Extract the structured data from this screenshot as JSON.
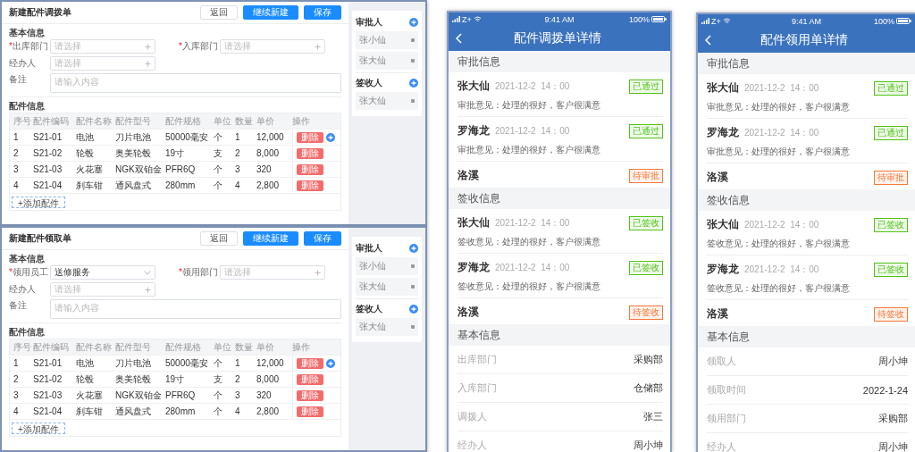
{
  "forms": [
    {
      "title": "新建配件调拨单",
      "buttons": [
        {
          "label": "返回",
          "kind": "default"
        },
        {
          "label": "继续新建",
          "kind": "primary"
        },
        {
          "label": "保存",
          "kind": "primary"
        }
      ],
      "basic_title": "基本信息",
      "fields": [
        {
          "mark": "*",
          "label": "出库部门",
          "kind": "picker",
          "placeholder": "请选择"
        },
        {
          "mark": "*",
          "label": "入库部门",
          "kind": "picker",
          "placeholder": "请选择"
        },
        {
          "label": "经办人",
          "kind": "picker",
          "placeholder": "请选择"
        },
        {
          "label": "备注",
          "kind": "textarea",
          "placeholder": "请输入内容"
        }
      ],
      "parts_title": "配件信息",
      "table": {
        "columns": [
          "序号",
          "配件编码",
          "配件名称",
          "配件型号",
          "配件规格",
          "单位",
          "数量",
          "单价",
          "操作"
        ],
        "rows": [
          {
            "cells": [
              "1",
              "S21-01",
              "电池",
              "刀片电池",
              "50000毫安",
              "个",
              "1",
              "12,000"
            ],
            "action": "删除",
            "add_icon": true
          },
          {
            "cells": [
              "2",
              "S21-02",
              "轮毂",
              "奥美轮毂",
              "19寸",
              "支",
              "2",
              "8,000"
            ],
            "action": "删除",
            "add_icon": false
          },
          {
            "cells": [
              "3",
              "S21-03",
              "火花塞",
              "NGK双铂金",
              "PFR6Q",
              "个",
              "3",
              "320"
            ],
            "action": "删除",
            "add_icon": false
          },
          {
            "cells": [
              "4",
              "S21-04",
              "刹车钳",
              "通风盘式",
              "280mm",
              "个",
              "4",
              "2,800"
            ],
            "action": "删除",
            "add_icon": false
          }
        ]
      },
      "add_button": "+添加配件",
      "panels": [
        {
          "title": "审批人",
          "people": [
            "张小仙",
            "张大仙"
          ]
        },
        {
          "title": "签收人",
          "people": [
            "张大仙"
          ]
        }
      ]
    },
    {
      "title": "新建配件领取单",
      "buttons": [
        {
          "label": "返回",
          "kind": "default"
        },
        {
          "label": "继续新建",
          "kind": "primary"
        },
        {
          "label": "保存",
          "kind": "primary"
        }
      ],
      "basic_title": "基本信息",
      "fields": [
        {
          "mark": "*",
          "label": "领用员工",
          "kind": "select",
          "value": "送修服务"
        },
        {
          "mark": "*",
          "label": "领用部门",
          "kind": "picker",
          "placeholder": "请选择"
        },
        {
          "label": "经办人",
          "kind": "picker",
          "placeholder": "请选择"
        },
        {
          "label": "备注",
          "kind": "textarea",
          "placeholder": "请输入内容"
        }
      ],
      "parts_title": "配件信息",
      "table": {
        "columns": [
          "序号",
          "配件编码",
          "配件名称",
          "配件型号",
          "配件规格",
          "单位",
          "数量",
          "单价",
          "操作"
        ],
        "rows": [
          {
            "cells": [
              "1",
              "S21-01",
              "电池",
              "刀片电池",
              "50000毫安",
              "个",
              "1",
              "12,000"
            ],
            "action": "删除",
            "add_icon": true
          },
          {
            "cells": [
              "2",
              "S21-02",
              "轮毂",
              "奥美轮毂",
              "19寸",
              "支",
              "2",
              "8,000"
            ],
            "action": "删除",
            "add_icon": false
          },
          {
            "cells": [
              "3",
              "S21-03",
              "火花塞",
              "NGK双铂金",
              "PFR6Q",
              "个",
              "3",
              "320"
            ],
            "action": "删除",
            "add_icon": false
          },
          {
            "cells": [
              "4",
              "S21-04",
              "刹车钳",
              "通风盘式",
              "280mm",
              "个",
              "4",
              "2,800"
            ],
            "action": "删除",
            "add_icon": false
          }
        ]
      },
      "add_button": "+添加配件",
      "panels": [
        {
          "title": "审批人",
          "people": [
            "张小仙",
            "张大仙"
          ]
        },
        {
          "title": "签收人",
          "people": [
            "张大仙"
          ]
        }
      ]
    }
  ],
  "phones": [
    {
      "status": {
        "carrier": "Z+",
        "time": "9:41 AM",
        "battery": "100%"
      },
      "title": "配件调拨单详情",
      "sections": [
        {
          "title": "审批信息",
          "kind": "records",
          "records": [
            {
              "name": "张大仙",
              "time": "2021-12-2  14：00",
              "status": "已通过",
              "color": "#52c41a",
              "comment": "审批意见：处理的很好，客户很满意"
            },
            {
              "name": "罗海龙",
              "time": "2021-12-2  14：00",
              "status": "已通过",
              "color": "#52c41a",
              "comment": "审批意见：处理的很好，客户很满意"
            },
            {
              "name": "洛溪",
              "status": "待审批",
              "color": "#f5793b"
            }
          ]
        },
        {
          "title": "签收信息",
          "kind": "records",
          "records": [
            {
              "name": "张大仙",
              "time": "2021-12-2  14：00",
              "status": "已签收",
              "color": "#52c41a",
              "comment": "签收意见：处理的很好，客户很满意"
            },
            {
              "name": "罗海龙",
              "time": "2021-12-2  14：00",
              "status": "已签收",
              "color": "#52c41a",
              "comment": "签收意见：处理的很好，客户很满意"
            },
            {
              "name": "洛溪",
              "status": "待签收",
              "color": "#f5793b"
            }
          ]
        },
        {
          "title": "基本信息",
          "kind": "fields",
          "rows": [
            {
              "label": "出库部门",
              "value": "采购部"
            },
            {
              "label": "入库部门",
              "value": "仓储部"
            },
            {
              "label": "调拨人",
              "value": "张三"
            },
            {
              "label": "经办人",
              "value": "周小坤"
            }
          ]
        }
      ]
    },
    {
      "status": {
        "carrier": "Z+",
        "time": "9:41 AM",
        "battery": "100%"
      },
      "title": "配件领用单详情",
      "sections": [
        {
          "title": "审批信息",
          "kind": "records",
          "records": [
            {
              "name": "张大仙",
              "time": "2021-12-2  14：00",
              "status": "已通过",
              "color": "#52c41a",
              "comment": "审批意见：处理的很好，客户很满意"
            },
            {
              "name": "罗海龙",
              "time": "2021-12-2  14：00",
              "status": "已通过",
              "color": "#52c41a",
              "comment": "审批意见：处理的很好，客户很满意"
            },
            {
              "name": "洛溪",
              "status": "待审批",
              "color": "#f5793b"
            }
          ]
        },
        {
          "title": "签收信息",
          "kind": "records",
          "records": [
            {
              "name": "张大仙",
              "time": "2021-12-2  14：00",
              "status": "已签收",
              "color": "#52c41a",
              "comment": "签收意见：处理的很好，客户很满意"
            },
            {
              "name": "罗海龙",
              "time": "2021-12-2  14：00",
              "status": "已签收",
              "color": "#52c41a",
              "comment": "签收意见：处理的很好，客户很满意"
            },
            {
              "name": "洛溪",
              "status": "待签收",
              "color": "#f5793b"
            }
          ]
        },
        {
          "title": "基本信息",
          "kind": "fields",
          "rows": [
            {
              "label": "领取人",
              "value": "周小坤"
            },
            {
              "label": "领取时间",
              "value": "2022-1-24"
            },
            {
              "label": "领用部门",
              "value": "采购部"
            },
            {
              "label": "经办人",
              "value": "周小坤"
            }
          ]
        }
      ]
    }
  ]
}
